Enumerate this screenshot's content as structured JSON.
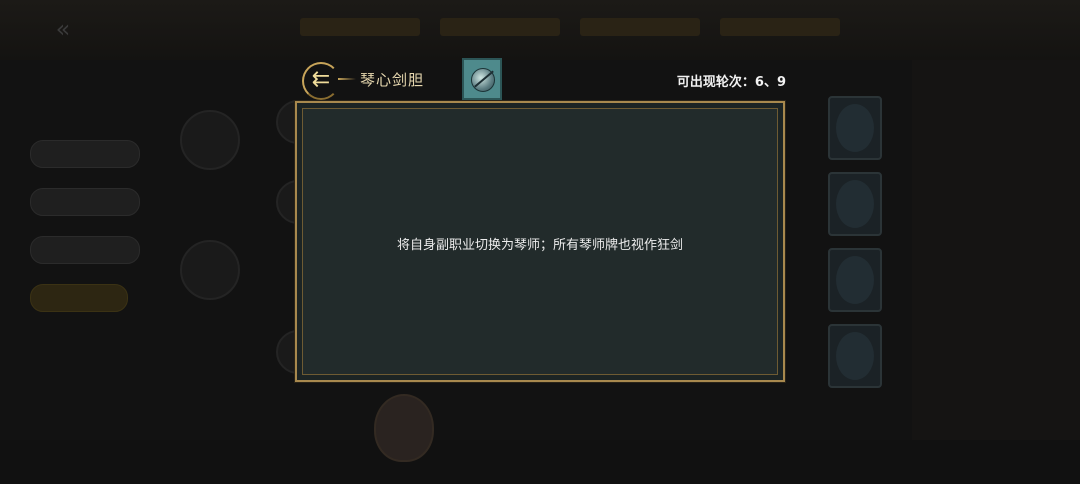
{
  "popup": {
    "skill_name": "琴心剑胆",
    "rounds_label": "可出现轮次：6、9",
    "description": "将自身副职业切换为琴师；所有琴师牌也视作狂剑"
  },
  "icons": {
    "skill_emblem": "arrow-emblem-icon",
    "card_thumbnail": "card-thumbnail-icon",
    "background_back": "back-arrow-icon"
  },
  "colors": {
    "frame_gold": "#a8894e",
    "panel_bg": "#222b2b",
    "title_text": "#e8d9b0",
    "body_text": "#ececec"
  }
}
